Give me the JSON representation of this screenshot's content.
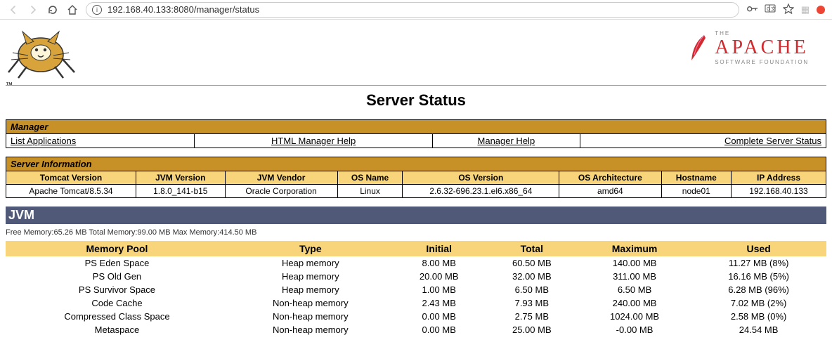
{
  "browser": {
    "url": "192.168.40.133:8080/manager/status"
  },
  "apache": {
    "the": "THE",
    "name": "APACHE",
    "sub": "SOFTWARE FOUNDATION"
  },
  "page_title": "Server Status",
  "manager": {
    "header": "Manager",
    "links": [
      "List Applications",
      "HTML Manager Help",
      "Manager Help",
      "Complete Server Status"
    ]
  },
  "server_info": {
    "header": "Server Information",
    "cols": [
      "Tomcat Version",
      "JVM Version",
      "JVM Vendor",
      "OS Name",
      "OS Version",
      "OS Architecture",
      "Hostname",
      "IP Address"
    ],
    "row": [
      "Apache Tomcat/8.5.34",
      "1.8.0_141-b15",
      "Oracle Corporation",
      "Linux",
      "2.6.32-696.23.1.el6.x86_64",
      "amd64",
      "node01",
      "192.168.40.133"
    ]
  },
  "jvm": {
    "title": "JVM",
    "summary": "Free Memory:65.26 MB Total Memory:99.00 MB Max Memory:414.50 MB",
    "cols": [
      "Memory Pool",
      "Type",
      "Initial",
      "Total",
      "Maximum",
      "Used"
    ],
    "rows": [
      [
        "PS Eden Space",
        "Heap memory",
        "8.00 MB",
        "60.50 MB",
        "140.00 MB",
        "11.27 MB (8%)"
      ],
      [
        "PS Old Gen",
        "Heap memory",
        "20.00 MB",
        "32.00 MB",
        "311.00 MB",
        "16.16 MB (5%)"
      ],
      [
        "PS Survivor Space",
        "Heap memory",
        "1.00 MB",
        "6.50 MB",
        "6.50 MB",
        "6.28 MB (96%)"
      ],
      [
        "Code Cache",
        "Non-heap memory",
        "2.43 MB",
        "7.93 MB",
        "240.00 MB",
        "7.02 MB (2%)"
      ],
      [
        "Compressed Class Space",
        "Non-heap memory",
        "0.00 MB",
        "2.75 MB",
        "1024.00 MB",
        "2.58 MB (0%)"
      ],
      [
        "Metaspace",
        "Non-heap memory",
        "0.00 MB",
        "25.00 MB",
        "-0.00 MB",
        "24.54 MB"
      ]
    ]
  }
}
